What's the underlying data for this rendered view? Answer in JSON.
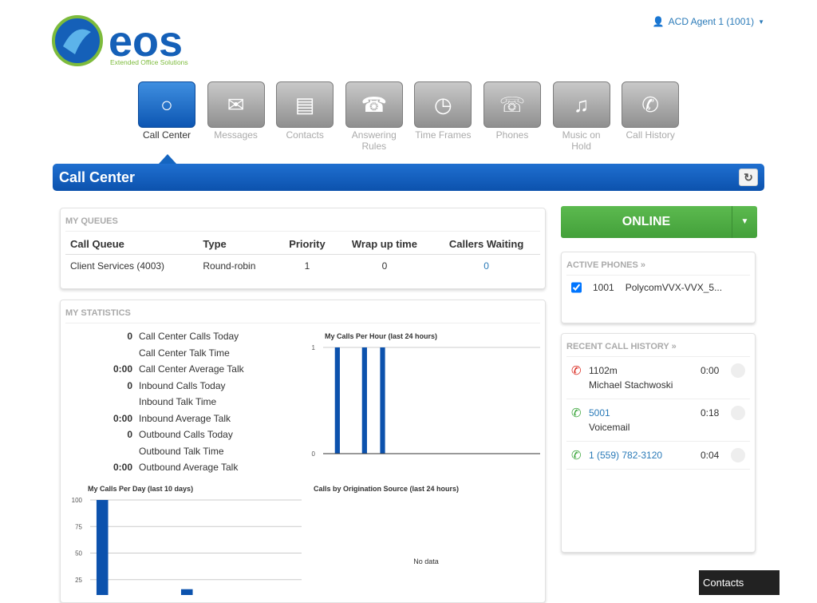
{
  "logo": {
    "text": "eos",
    "tagline": "Extended Office Solutions"
  },
  "user": {
    "icon": "user-icon",
    "label": "ACD Agent 1 (1001)"
  },
  "nav": [
    {
      "label": "Call Center",
      "icon": "headset-icon",
      "active": true
    },
    {
      "label": "Messages",
      "icon": "envelope-icon"
    },
    {
      "label": "Contacts",
      "icon": "contact-card-icon"
    },
    {
      "label": "Answering Rules",
      "icon": "phone-waves-icon"
    },
    {
      "label": "Time Frames",
      "icon": "clock-icon"
    },
    {
      "label": "Phones",
      "icon": "phone-handset-icon"
    },
    {
      "label": "Music on Hold",
      "icon": "music-note-icon"
    },
    {
      "label": "Call History",
      "icon": "call-history-icon"
    }
  ],
  "page_title": "Call Center",
  "queues": {
    "title": "MY QUEUES",
    "headers": [
      "Call Queue",
      "Type",
      "Priority",
      "Wrap up time",
      "Callers Waiting"
    ],
    "rows": [
      [
        "Client Services (4003)",
        "Round-robin",
        "1",
        "0",
        "0"
      ]
    ]
  },
  "stats": {
    "title": "MY STATISTICS",
    "items": [
      {
        "value": "0",
        "label": "Call Center Calls Today"
      },
      {
        "value": "",
        "label": "Call Center Talk Time"
      },
      {
        "value": "0:00",
        "label": "Call Center Average Talk"
      },
      {
        "value": "0",
        "label": "Inbound Calls Today"
      },
      {
        "value": "",
        "label": "Inbound Talk Time"
      },
      {
        "value": "0:00",
        "label": "Inbound Average Talk"
      },
      {
        "value": "0",
        "label": "Outbound Calls Today"
      },
      {
        "value": "",
        "label": "Outbound Talk Time"
      },
      {
        "value": "0:00",
        "label": "Outbound Average Talk"
      }
    ]
  },
  "chart_data": [
    {
      "type": "bar",
      "title": "My Calls Per Hour (last 24 hours)",
      "ylim": [
        0,
        1
      ],
      "yticks": [
        "0",
        "1"
      ],
      "values": [
        0,
        1,
        0,
        0,
        1,
        0,
        1,
        0,
        0,
        0,
        0,
        0,
        0,
        0,
        0,
        0,
        0,
        0,
        0,
        0,
        0,
        0,
        0,
        0
      ]
    },
    {
      "type": "bar",
      "title": "My Calls Per Day (last 10 days)",
      "ylim": [
        0,
        100
      ],
      "yticks": [
        "25",
        "50",
        "75",
        "100"
      ],
      "values": [
        100,
        0,
        0,
        0,
        16,
        0,
        0,
        0,
        0,
        0
      ]
    },
    {
      "type": "pie",
      "title": "Calls by Origination Source (last 24 hours)",
      "empty_text": "No data"
    }
  ],
  "status": {
    "label": "ONLINE",
    "color": "#4cae43"
  },
  "active_phones": {
    "title": "ACTIVE PHONES »",
    "items": [
      {
        "checked": true,
        "ext": "1001",
        "device": "PolycomVVX-VVX_5..."
      }
    ]
  },
  "history": {
    "title": "RECENT CALL HISTORY »",
    "items": [
      {
        "icon": "missed-call-icon",
        "number": "1102m",
        "name": "Michael Stachwoski",
        "duration": "0:00",
        "link": false
      },
      {
        "icon": "outgoing-call-icon",
        "number": "5001",
        "name": "Voicemail",
        "duration": "0:18",
        "link": true
      },
      {
        "icon": "outgoing-call-icon",
        "number": "1 (559) 782-3120",
        "name": "",
        "duration": "0:04",
        "link": true
      }
    ]
  },
  "contacts_tab": "Contacts"
}
